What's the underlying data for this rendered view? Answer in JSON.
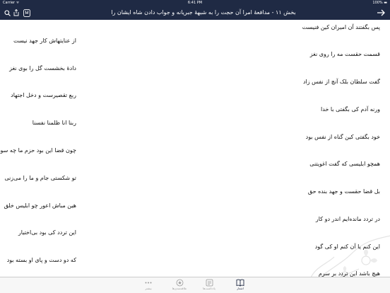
{
  "status_bar": {
    "carrier": "Carrier ᯤ",
    "time": "6:41 PM",
    "battery": "100% ▬"
  },
  "nav": {
    "title": "بخش ۱۱ - مدافعهٔ امرا آن حجت را به شبههٔ جبریانه و جواب دادن شاه ایشان را"
  },
  "verses_right": [
    "پس بگفتند آن امیران کین فنیست",
    "قسمت حقست مه را روی نغز",
    "گفت سلطان بلک آنچ از نفس زاد",
    "ورنه آدم کی بگفتی با خدا",
    "خود بگفتی کین گناه از نفس بود",
    "همچو ابلیسی که گفت اغویتنی",
    "بل قضا حقست و جهد بنده حق",
    "در تردد مانده‌ایم اندر دو کار",
    "این کنم یا آن کنم او کی گود",
    "هیچ باشد این تردد بر سرم"
  ],
  "verses_left": [
    "از عنایتهاش کار جهد نیست",
    "دادهٔ بخشست گل را بوی نغز",
    "ربع تقصیرست و دخل اجتهاد",
    "ربنا انا ظلمنا نفسنا",
    "چون قضا این بود حزم ما چه سود",
    "تو شکستی جام و ما را می‌زنی",
    "هین مباش اعور چو ابلیس خلق",
    "این تردد کی بود بی‌اختیار",
    "که دو دست و پای او بسته بود"
  ],
  "tabs": [
    {
      "label": "اشعار",
      "icon": "book-icon",
      "active": true
    },
    {
      "label": "یادداشت‌ها",
      "icon": "notes-icon",
      "active": false
    },
    {
      "label": "علاقه‌مندی‌ها",
      "icon": "favorites-icon",
      "active": false
    },
    {
      "label": "بیشتر",
      "icon": "more-icon",
      "active": false
    }
  ],
  "colors": {
    "nav_background": "#1f2a44",
    "tab_active": "#1f2a44",
    "tab_inactive": "#9a9a9a"
  }
}
